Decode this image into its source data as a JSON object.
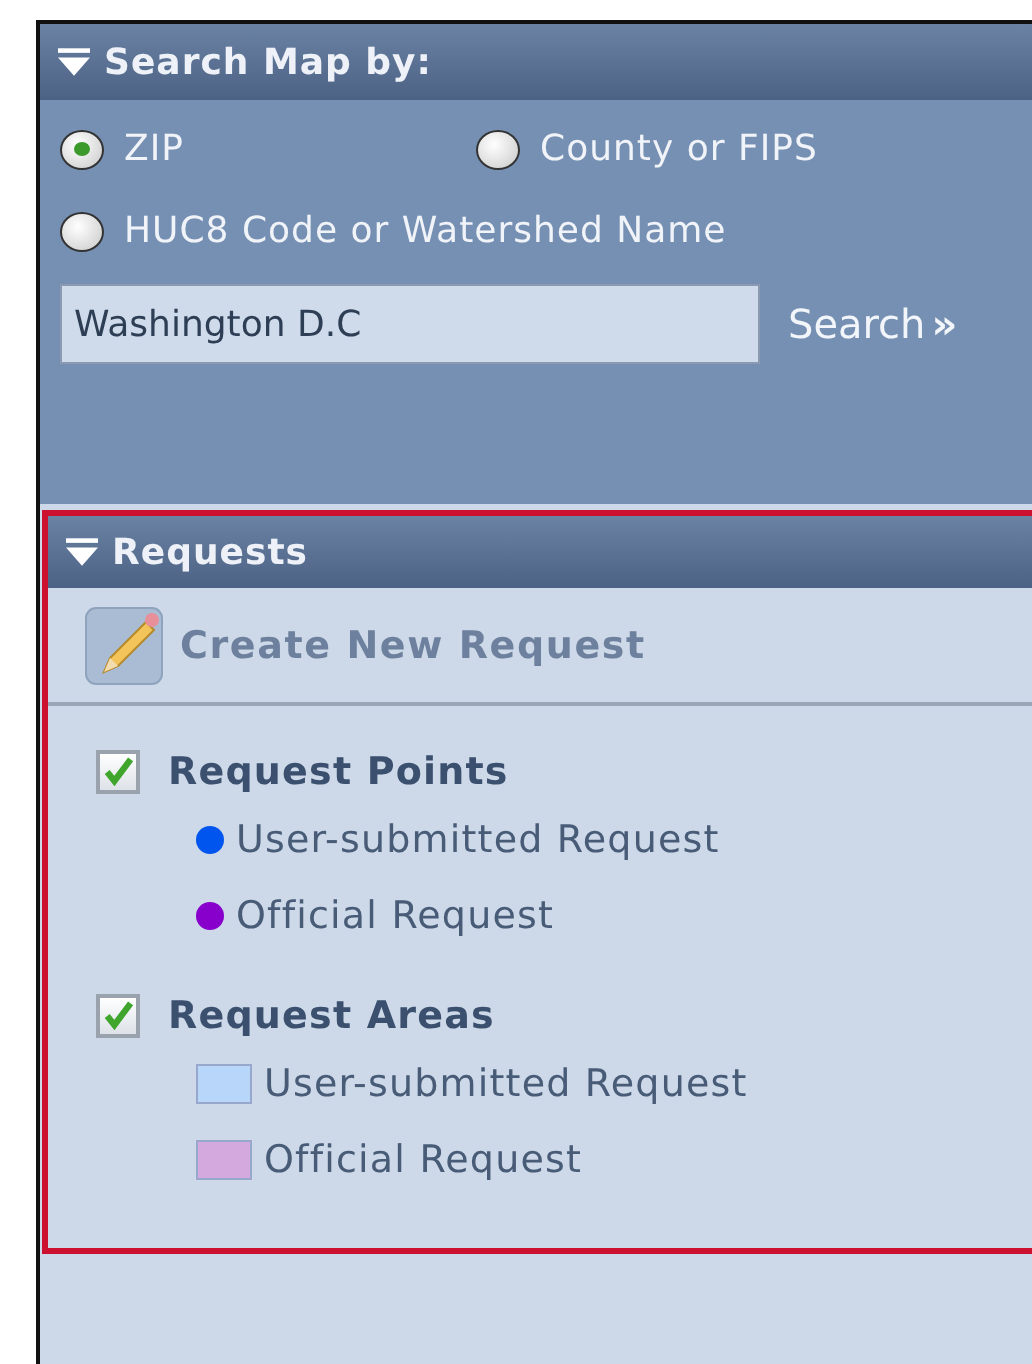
{
  "search_panel": {
    "title": "Search Map by:",
    "expanded": true,
    "options": [
      {
        "label": "ZIP",
        "selected": true
      },
      {
        "label": "County or FIPS",
        "selected": false
      },
      {
        "label": "HUC8 Code or Watershed Name",
        "selected": false
      }
    ],
    "query": {
      "value": "Washington D.C"
    },
    "search_button": "Search",
    "search_arrow": "»"
  },
  "requests_panel": {
    "title": "Requests",
    "expanded": true,
    "create_button": "Create New Request",
    "layers": [
      {
        "label": "Request Points",
        "checked": true,
        "legend": [
          {
            "kind": "dot",
            "label": "User-submitted Request",
            "color": "#0055ee"
          },
          {
            "kind": "dot",
            "label": "Official Request",
            "color": "#8800cc"
          }
        ]
      },
      {
        "label": "Request Areas",
        "checked": true,
        "legend": [
          {
            "kind": "square",
            "label": "User-submitted Request",
            "color": "#b8d6fa"
          },
          {
            "kind": "square",
            "label": "Official Request",
            "color": "#d4aade"
          }
        ]
      }
    ]
  }
}
